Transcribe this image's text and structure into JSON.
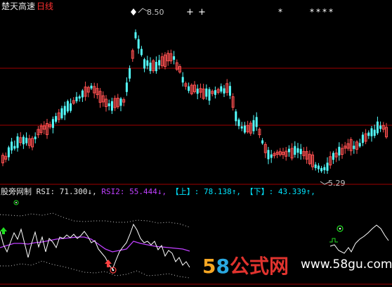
{
  "header": {
    "stock_name": "楚天高速",
    "period_label": "日线"
  },
  "price_chart": {
    "high_label": "8.50",
    "low_label": "5.29"
  },
  "indicator": {
    "name": "股旁网制",
    "rsi_label": "RSI:",
    "rsi_value": "71.300",
    "rsi_arrow": "↓,",
    "rsi2_label": "RSI2:",
    "rsi2_value": "55.444",
    "rsi2_arrow": "↓,",
    "upper_label": "【上】:",
    "upper_value": "78.138",
    "upper_arrow": "↑,",
    "lower_label": "【下】:",
    "lower_value": "43.339",
    "lower_arrow": "↑,"
  },
  "watermark": {
    "digits1": "5",
    "digits2": "8",
    "chinese": "公式网",
    "url": "www.58gu.com"
  },
  "colors": {
    "background": "#000000",
    "grid": "#a00000",
    "candle_up": "#ff5050",
    "candle_down": "#54ffff",
    "rsi2_line": "#c040ff"
  }
}
